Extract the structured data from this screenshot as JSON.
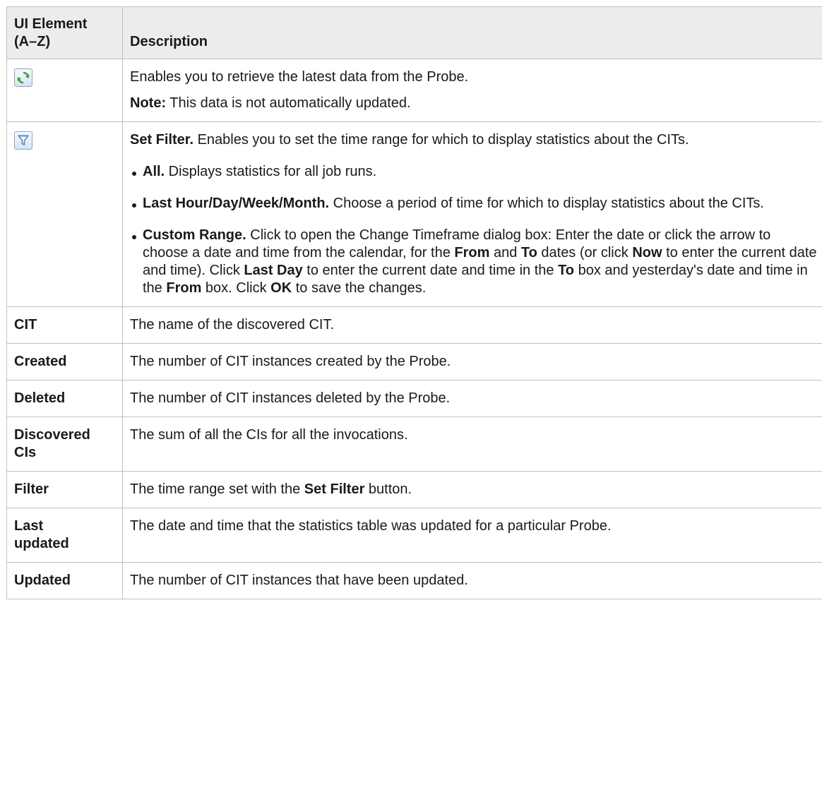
{
  "header": {
    "col1_line1": "UI Element",
    "col1_line2": "(A–Z)",
    "col2": "Description"
  },
  "icons": {
    "refresh": "refresh-icon",
    "filter": "filter-icon"
  },
  "rows": {
    "refresh": {
      "desc": "Enables you to retrieve the latest data from the Probe.",
      "note_label": "Note:",
      "note_text": " This data is not automatically updated."
    },
    "filter": {
      "lead_bold": "Set Filter.",
      "lead_text": " Enables you to set the time range for which to display statistics about the CITs.",
      "bullets": {
        "all": {
          "bold": "All.",
          "text": " Displays statistics for all job runs."
        },
        "last": {
          "bold": "Last Hour/Day/Week/Month.",
          "text": " Choose a period of time for which to display statistics about the CITs."
        },
        "custom": {
          "bold": "Custom Range.",
          "t1": " Click to open the Change Timeframe dialog box: Enter the date or click the arrow to choose a date and time from the calendar, for the ",
          "b_from": "From",
          "t2": " and ",
          "b_to": "To",
          "t3": " dates (or click ",
          "b_now": "Now",
          "t4": " to enter the current date and time). Click ",
          "b_lastday": "Last Day",
          "t5": " to enter the current date and time in the ",
          "b_to2": "To",
          "t6": " box and yesterday's date and time in the ",
          "b_from2": "From",
          "t7": " box. Click ",
          "b_ok": "OK",
          "t8": " to save the changes."
        }
      }
    },
    "cit": {
      "term": "CIT",
      "desc": "The name of the discovered CIT."
    },
    "created": {
      "term": "Created",
      "desc": "The number of CIT instances created by the Probe."
    },
    "deleted": {
      "term": "Deleted",
      "desc": "The number of CIT instances deleted by the Probe."
    },
    "discovered": {
      "term_line1": "Discovered",
      "term_line2": "CIs",
      "desc": "The sum of all the CIs for all the invocations."
    },
    "filter_term": {
      "term": "Filter",
      "t1": "The time range set with the ",
      "b": "Set Filter",
      "t2": " button."
    },
    "last_updated": {
      "term_line1": "Last",
      "term_line2": "updated",
      "desc": "The date and time that the statistics table was updated for a particular Probe."
    },
    "updated": {
      "term": "Updated",
      "desc": "The number of CIT instances that have been updated."
    }
  },
  "colors": {
    "header_bg": "#ececec",
    "border": "#bfbfbf",
    "refresh_green": "#3aa335",
    "filter_blue": "#5b86b8"
  }
}
